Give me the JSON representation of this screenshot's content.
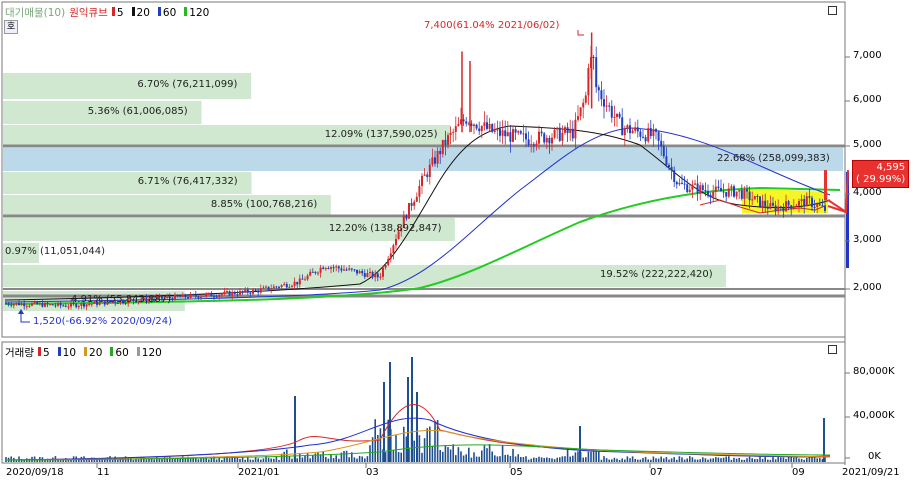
{
  "price_panel": {
    "legend": {
      "title": "대기매물(10)",
      "indicator": "원익큐브",
      "ma": [
        {
          "label": "5",
          "color": "#d62728"
        },
        {
          "label": "20",
          "color": "#111111"
        },
        {
          "label": "60",
          "color": "#1f3fbf"
        },
        {
          "label": "120",
          "color": "#22bb22"
        }
      ],
      "toggle": "호"
    },
    "y_ticks": [
      "7,000",
      "6,000",
      "5,000",
      "4,000",
      "3,000",
      "2,000"
    ],
    "high_annotation": "7,400(61.04% 2021/06/02)",
    "low_annotation": "1,520(-66.92% 2020/09/24)",
    "current_price": {
      "value": "4,595",
      "change": "( 29.99%)"
    },
    "volume_profile": [
      {
        "label": "6.70% (76,211,099)",
        "fraction": 0.067
      },
      {
        "label": "5.36% (61,006,085)",
        "fraction": 0.0536
      },
      {
        "label": "12.09% (137,590,025)",
        "fraction": 0.1209
      },
      {
        "label": "22.68% (258,099,383)",
        "fraction": 0.2268
      },
      {
        "label": "6.71% (76,417,332)",
        "fraction": 0.0671
      },
      {
        "label": "8.85% (100,768,216)",
        "fraction": 0.0885
      },
      {
        "label": "12.20% (138,892,847)",
        "fraction": 0.122
      },
      {
        "label": "0.97% (11,051,044)",
        "fraction": 0.0097
      },
      {
        "label": "19.52% (222,222,420)",
        "fraction": 0.1952
      },
      {
        "label": "4.91% (55,843,887)",
        "fraction": 0.0491
      }
    ]
  },
  "volume_panel": {
    "legend": {
      "title": "거래량",
      "ma": [
        {
          "label": "5",
          "color": "#d62728"
        },
        {
          "label": "10",
          "color": "#1f3fbf"
        },
        {
          "label": "20",
          "color": "#d8951f"
        },
        {
          "label": "60",
          "color": "#22aa22"
        },
        {
          "label": "120",
          "color": "#999999"
        }
      ]
    },
    "y_ticks": [
      "80,000K",
      "40,000K",
      "0K"
    ]
  },
  "x_axis": {
    "labels": [
      "2020/09/18",
      "11",
      "2021/01",
      "03",
      "05",
      "07",
      "09",
      "2021/09/21"
    ]
  },
  "chart_data": {
    "type": "candlestick",
    "x_range": [
      "2020/09/18",
      "2021/09/21"
    ],
    "ylim": [
      1000,
      7800
    ],
    "high": {
      "date": "2021/06/02",
      "value": 7400,
      "change_pct": 61.04
    },
    "low": {
      "date": "2020/09/24",
      "value": 1520,
      "change_pct": -66.92
    },
    "last": {
      "date": "2021/09/21",
      "value": 4595,
      "change_pct": 29.99
    },
    "close_series": [
      [
        "2020/09/18",
        1700
      ],
      [
        "2020/10/15",
        1650
      ],
      [
        "2020/11/10",
        1750
      ],
      [
        "2020/12/10",
        1850
      ],
      [
        "2021/01/05",
        1950
      ],
      [
        "2021/01/25",
        2150
      ],
      [
        "2021/02/05",
        2500
      ],
      [
        "2021/02/20",
        2350
      ],
      [
        "2021/03/01",
        2250
      ],
      [
        "2021/03/10",
        3300
      ],
      [
        "2021/03/20",
        4300
      ],
      [
        "2021/03/30",
        5100
      ],
      [
        "2021/04/08",
        5600
      ],
      [
        "2021/04/20",
        5300
      ],
      [
        "2021/05/05",
        5150
      ],
      [
        "2021/05/25",
        5300
      ],
      [
        "2021/06/02",
        6400
      ],
      [
        "2021/06/15",
        5400
      ],
      [
        "2021/06/30",
        5200
      ],
      [
        "2021/07/10",
        4200
      ],
      [
        "2021/07/25",
        4050
      ],
      [
        "2021/08/05",
        4050
      ],
      [
        "2021/08/20",
        3700
      ],
      [
        "2021/09/05",
        3850
      ],
      [
        "2021/09/17",
        3550
      ],
      [
        "2021/09/21",
        4595
      ]
    ]
  }
}
